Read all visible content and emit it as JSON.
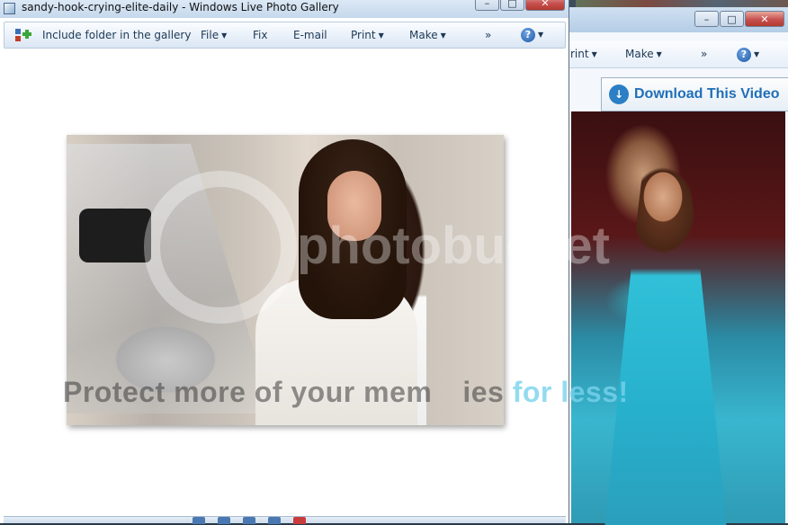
{
  "front_window": {
    "title": "sandy-hook-crying-elite-daily - Windows Live Photo Gallery",
    "toolbar": {
      "include_folder": "Include folder in the gallery",
      "file": "File",
      "fix": "Fix",
      "email": "E-mail",
      "print": "Print",
      "make": "Make",
      "more": "»",
      "help": "?"
    },
    "window_controls": {
      "minimize": "–",
      "maximize": "□",
      "close": "✕"
    }
  },
  "back_window": {
    "toolbar": {
      "print_partial": "rint",
      "make": "Make",
      "more": "»",
      "help": "?"
    },
    "download_bar": "Download This Video",
    "window_controls": {
      "minimize": "–",
      "maximize": "□",
      "close": "✕"
    }
  },
  "watermark": {
    "text_start": "Protect more of your mem",
    "text_end": "ies for less!",
    "accent": "for less!",
    "brand": "photobucket"
  },
  "colors": {
    "titlebar": "#c5d8ec",
    "toolbar_text": "#1e3955",
    "download_text": "#1f6fb8",
    "close_button": "#c75050"
  },
  "icons": [
    "folder-add-icon",
    "help-icon",
    "download-icon",
    "window-icon"
  ]
}
